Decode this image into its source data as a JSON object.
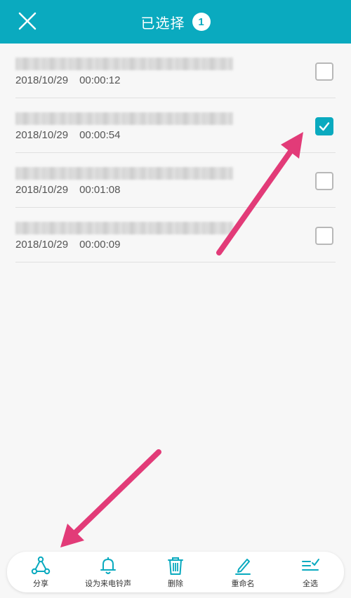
{
  "header": {
    "title": "已选择",
    "count": "1"
  },
  "colors": {
    "accent": "#0aaabf",
    "annotation_arrow": "#e23b78"
  },
  "recordings": [
    {
      "name": "",
      "date": "2018/10/29",
      "duration": "00:00:12",
      "checked": false
    },
    {
      "name": "",
      "date": "2018/10/29",
      "duration": "00:00:54",
      "checked": true
    },
    {
      "name": "",
      "date": "2018/10/29",
      "duration": "00:01:08",
      "checked": false
    },
    {
      "name": "",
      "date": "2018/10/29",
      "duration": "00:00:09",
      "checked": false
    }
  ],
  "toolbar": {
    "share_label": "分享",
    "ringtone_label": "设为来电铃声",
    "delete_label": "删除",
    "rename_label": "重命名",
    "select_all_label": "全选"
  },
  "icons": {
    "close": "close-icon",
    "share": "share-icon",
    "ringtone": "bell-icon",
    "delete": "trash-icon",
    "rename": "pencil-icon",
    "select_all": "checklist-icon"
  }
}
